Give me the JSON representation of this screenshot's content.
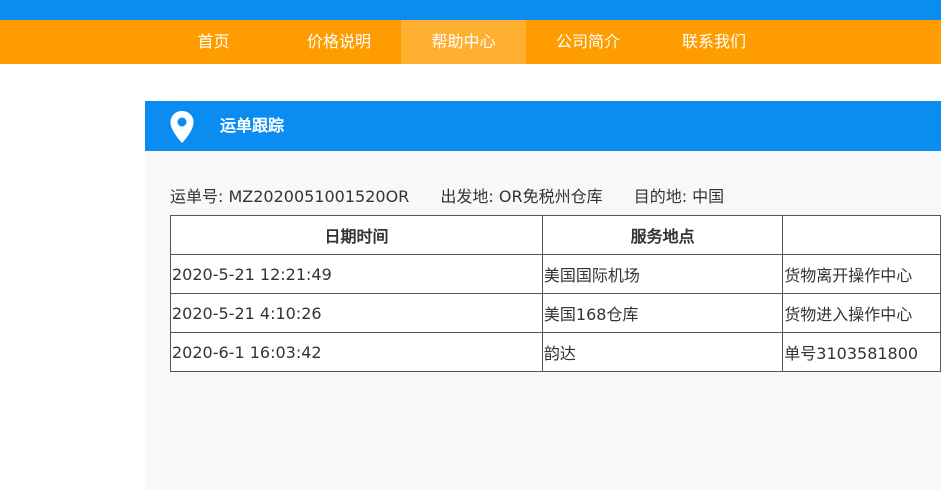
{
  "nav": {
    "items": [
      {
        "label": "首页"
      },
      {
        "label": "价格说明"
      },
      {
        "label": "帮助中心"
      },
      {
        "label": "公司简介"
      },
      {
        "label": "联系我们"
      }
    ]
  },
  "panel": {
    "title": "运单跟踪"
  },
  "shipment": {
    "tracking_no": "运单号: MZ2020051001520OR",
    "origin": "出发地: OR免税州仓库",
    "destination": "目的地: 中国"
  },
  "table": {
    "headers": [
      "日期时间",
      "服务地点",
      ""
    ],
    "rows": [
      [
        "2020-5-21 12:21:49",
        "美国国际机场",
        "货物离开操作中心"
      ],
      [
        "2020-5-21 4:10:26",
        "美国168仓库",
        "货物进入操作中心"
      ],
      [
        "2020-6-1 16:03:42",
        "韵达",
        "单号3103581800"
      ]
    ]
  }
}
